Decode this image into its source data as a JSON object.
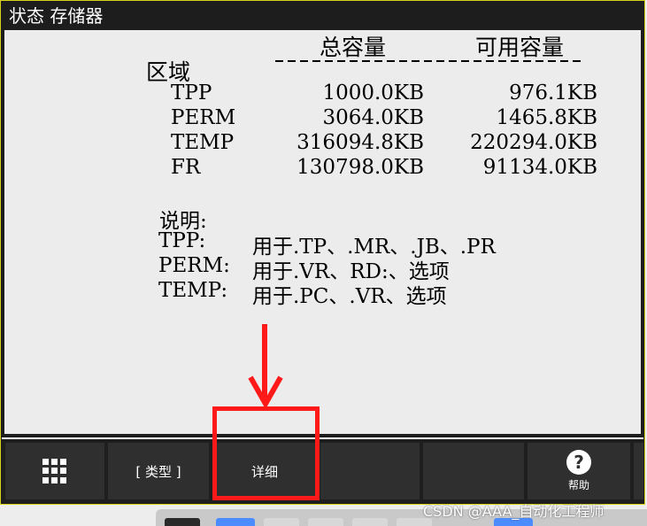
{
  "window": {
    "title": "状态 存储器"
  },
  "table": {
    "col_total": "总容量",
    "col_available": "可用容量",
    "row_header": "区域",
    "rows": [
      {
        "area": "TPP",
        "total": "1000.0KB",
        "available": "976.1KB"
      },
      {
        "area": "PERM",
        "total": "3064.0KB",
        "available": "1465.8KB"
      },
      {
        "area": "TEMP",
        "total": "316094.8KB",
        "available": "220294.0KB"
      },
      {
        "area": "FR",
        "total": "130798.0KB",
        "available": "91134.0KB"
      }
    ]
  },
  "notes": {
    "heading": "说明:",
    "lines": [
      {
        "key": "TPP:",
        "text": "用于.TP、.MR、.JB、.PR"
      },
      {
        "key": "PERM:",
        "text": "用于.VR、RD:、选项"
      },
      {
        "key": "TEMP:",
        "text": "用于.PC、.VR、选项"
      }
    ]
  },
  "softkeys": {
    "type_label": "[ 类型 ]",
    "detail_label": "详细",
    "help_label": "帮助",
    "help_icon_glyph": "?"
  },
  "icons": {
    "menu": "grid-icon",
    "help": "help-icon"
  },
  "annotation": {
    "color": "#ff1a1a"
  },
  "watermark": "CSDN @AAA_自动化工程师"
}
